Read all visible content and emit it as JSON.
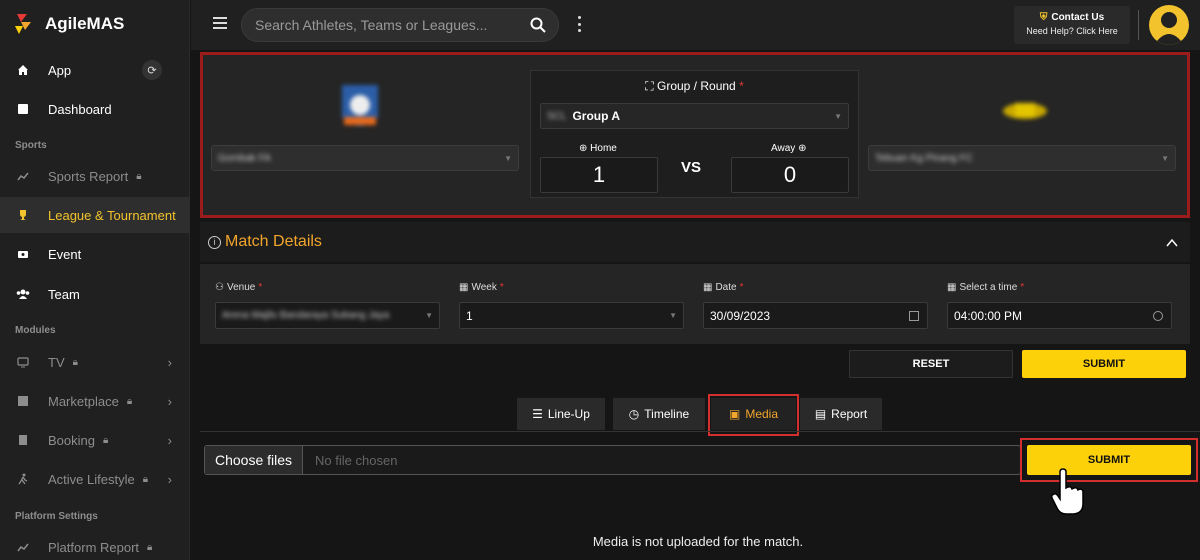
{
  "app": {
    "name": "AgileMAS"
  },
  "sidebar": {
    "items": [
      {
        "label": "App",
        "icon": "home-icon"
      },
      {
        "label": "Dashboard",
        "icon": "dashboard-icon"
      },
      {
        "label": "Sports Report",
        "icon": "chart-line-icon",
        "locked": true
      },
      {
        "label": "League & Tournament",
        "icon": "trophy-icon",
        "active": true
      },
      {
        "label": "Event",
        "icon": "ticket-icon"
      },
      {
        "label": "Team",
        "icon": "team-icon"
      },
      {
        "label": "TV",
        "icon": "tv-icon",
        "locked": true
      },
      {
        "label": "Marketplace",
        "icon": "store-icon",
        "locked": true
      },
      {
        "label": "Booking",
        "icon": "building-icon",
        "locked": true
      },
      {
        "label": "Active Lifestyle",
        "icon": "runner-icon",
        "locked": true
      },
      {
        "label": "Platform Report",
        "icon": "chart-line-icon",
        "locked": true
      }
    ],
    "sections": {
      "sports": "Sports",
      "modules": "Modules",
      "platform": "Platform Settings"
    }
  },
  "topbar": {
    "search_placeholder": "Search Athletes, Teams or Leagues...",
    "contact_title": "Contact Us",
    "contact_subtitle": "Need Help? Click Here"
  },
  "match": {
    "home_team": "Gombak FA",
    "away_team": "Tebuan Kg Pinang FC",
    "group_label": "Group / Round",
    "group_prefix": "SCL",
    "group_value": "Group A",
    "home_label": "Home",
    "away_label": "Away",
    "vs": "VS",
    "home_score": "1",
    "away_score": "0"
  },
  "details": {
    "title": "Match Details",
    "venue_label": "Venue",
    "venue_value": "Arena Majlis Bandaraya Subang Jaya",
    "week_label": "Week",
    "week_value": "1",
    "date_label": "Date",
    "date_value": "30/09/2023",
    "time_label": "Select a time",
    "time_value": "04:00:00 PM",
    "reset_label": "RESET",
    "submit_label": "SUBMIT"
  },
  "tabs": [
    {
      "label": "Line-Up",
      "icon": "list-icon"
    },
    {
      "label": "Timeline",
      "icon": "clock-icon"
    },
    {
      "label": "Media",
      "icon": "media-icon",
      "active": true
    },
    {
      "label": "Report",
      "icon": "document-icon"
    }
  ],
  "media": {
    "choose_files": "Choose files",
    "no_file": "No file chosen",
    "submit_label": "SUBMIT",
    "empty_message": "Media is not uploaded for the match."
  },
  "colors": {
    "accent": "#fcd109",
    "highlight": "#d32f2f",
    "title": "#f2a52c"
  }
}
